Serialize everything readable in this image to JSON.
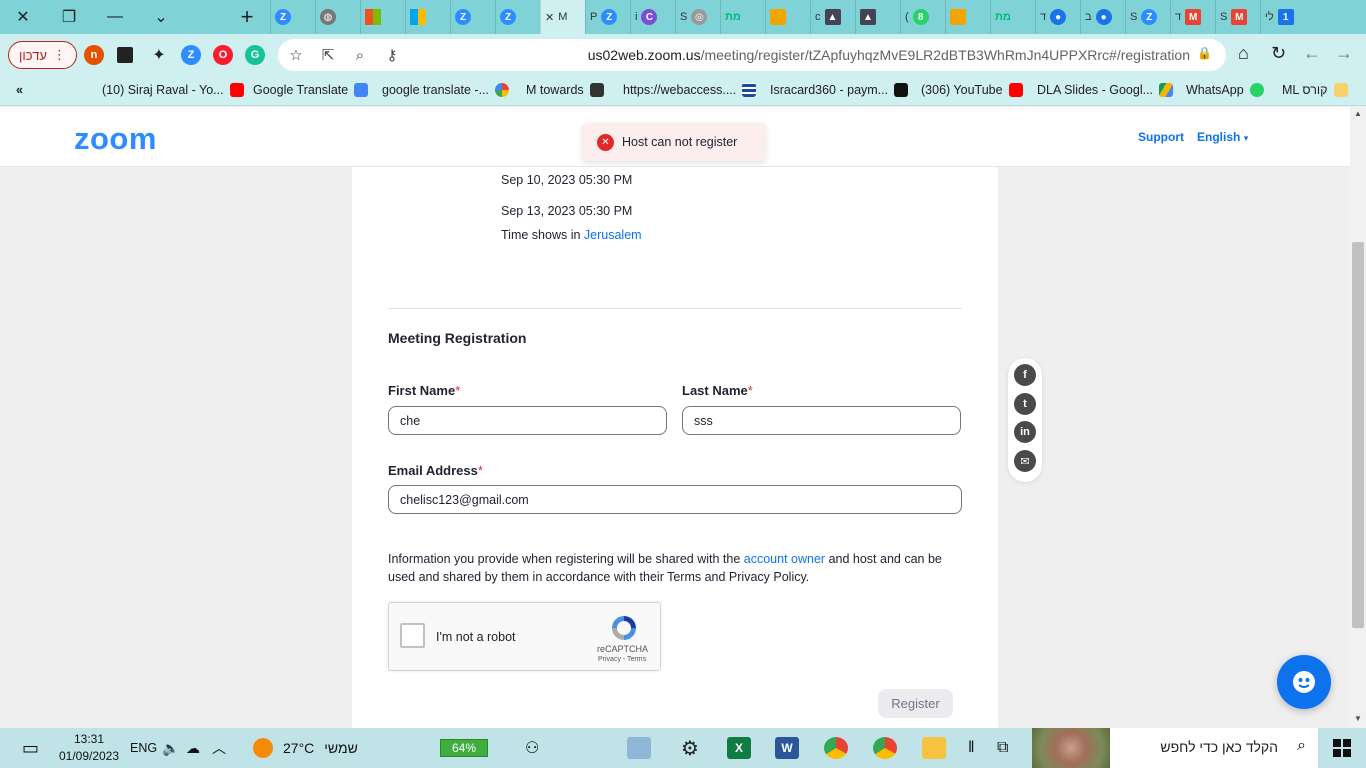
{
  "browser": {
    "tab_labels": [
      "S",
      "M",
      "P",
      "i",
      "S",
      "מת",
      "c",
      "(",
      "מת",
      "ד",
      "ב",
      "S",
      "ד",
      "S",
      "לי"
    ],
    "active_tab_label": "M",
    "update_button": "עדכון",
    "url_host": "us02web.zoom.us",
    "url_path": "/meeting/register/tZApfuyhqzMvE9LR2dBTB3WhRmJn4UPPXRrc#/registration",
    "bookmarks_chevron": "«",
    "bookmarks": [
      "(10) Siraj Raval - Yo...",
      "Google Translate",
      "google translate -...",
      "M towards",
      "https://webaccess....",
      "Isracard360 - paym...",
      "(306) YouTube",
      "DLA Slides - Googl...",
      "WhatsApp",
      "ML קורס"
    ]
  },
  "header": {
    "logo": "zoom",
    "support": "Support",
    "language": "English"
  },
  "toast": {
    "message": "Host can not register"
  },
  "schedule": {
    "dates": [
      "Sep 10, 2023 05:30 PM",
      "Sep 13, 2023 05:30 PM"
    ],
    "timezone_prefix": "Time shows in",
    "timezone": "Jerusalem"
  },
  "form": {
    "title": "Meeting Registration",
    "first_name_label": "First Name",
    "first_name_value": "che",
    "last_name_label": "Last Name",
    "last_name_value": "sss",
    "email_label": "Email Address",
    "email_value": "chelisc123@gmail.com",
    "required_mark": "*",
    "info_part1": "Information you provide when registering will be shared with the",
    "info_link": "account owner",
    "info_part2": "and host and can be used and shared by them in accordance with their Terms and Privacy Policy.",
    "captcha_label": "I'm not a robot",
    "captcha_brand": "reCAPTCHA",
    "captcha_terms": "Privacy - Terms",
    "register_button": "Register"
  },
  "taskbar": {
    "time": "13:31",
    "date": "01/09/2023",
    "language": "ENG",
    "temperature": "27°C",
    "weather_label": "שמשי",
    "battery": "64%",
    "search_placeholder": "הקלד כאן כדי לחפש"
  },
  "colors": {
    "zoom_blue": "#2d8cff",
    "link_blue": "#0e72ed",
    "error_red": "#e02828",
    "chrome_tab_bg": "#7fd3d6"
  }
}
